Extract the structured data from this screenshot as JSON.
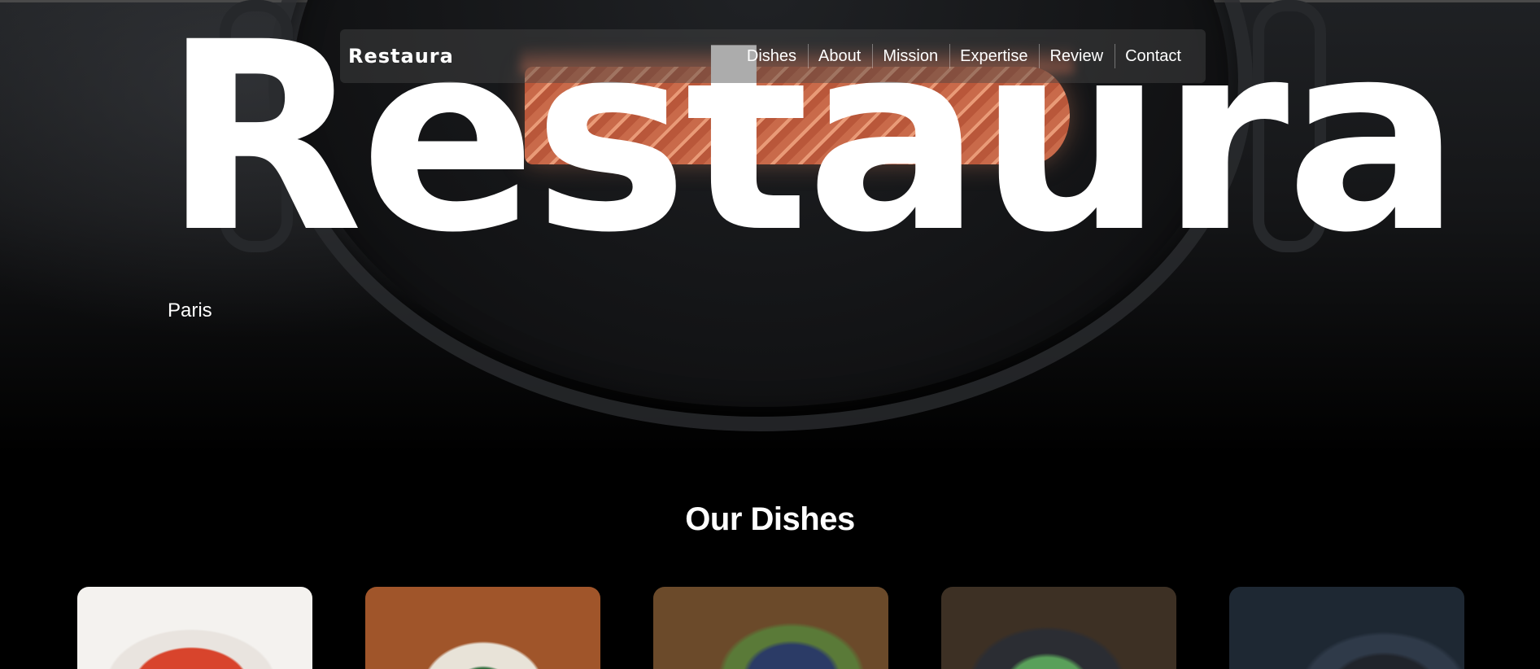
{
  "hero": {
    "title": "Restaura",
    "subtitle": "Paris"
  },
  "header": {
    "logo": "Restaura",
    "nav": [
      "Dishes",
      "About",
      "Mission",
      "Expertise",
      "Review",
      "Contact"
    ]
  },
  "dishes": {
    "title": "Our Dishes",
    "cards": [
      "tomato-soup",
      "noodle-bowl",
      "chickpea-bowl",
      "egg-salad",
      "blueberry-dessert"
    ]
  }
}
